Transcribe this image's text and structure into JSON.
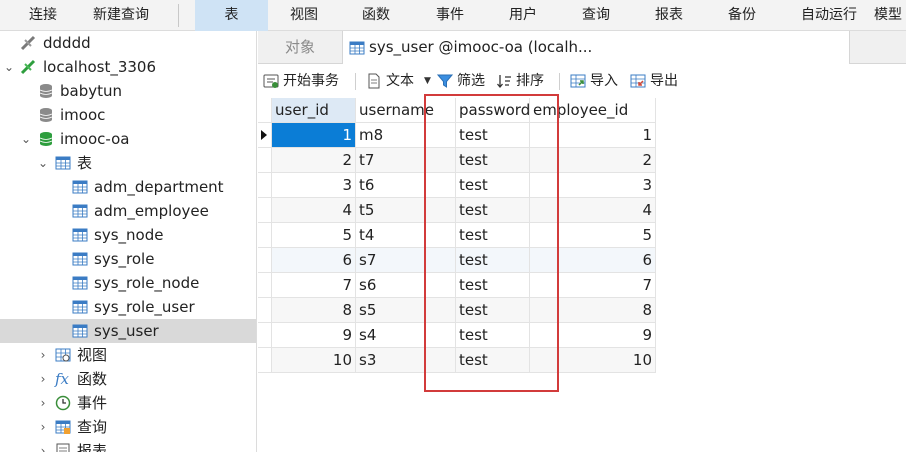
{
  "menubar": {
    "items": [
      {
        "label": "连接"
      },
      {
        "label": "新建查询"
      },
      {
        "label": "表"
      },
      {
        "label": "视图"
      },
      {
        "label": "函数"
      },
      {
        "label": "事件"
      },
      {
        "label": "用户"
      },
      {
        "label": "查询"
      },
      {
        "label": "报表"
      },
      {
        "label": "备份"
      },
      {
        "label": "自动运行"
      },
      {
        "label": "模型"
      }
    ],
    "active": "表"
  },
  "sidebar": {
    "items": [
      {
        "label": "ddddd",
        "icon": "connection-icon"
      },
      {
        "label": "localhost_3306",
        "icon": "connection-icon"
      },
      {
        "label": "babytun",
        "icon": "database-icon"
      },
      {
        "label": "imooc",
        "icon": "database-icon"
      },
      {
        "label": "imooc-oa",
        "icon": "database-icon"
      },
      {
        "label": "表",
        "icon": "tables-folder-icon"
      },
      {
        "label": "adm_department",
        "icon": "table-icon"
      },
      {
        "label": "adm_employee",
        "icon": "table-icon"
      },
      {
        "label": "sys_node",
        "icon": "table-icon"
      },
      {
        "label": "sys_role",
        "icon": "table-icon"
      },
      {
        "label": "sys_role_node",
        "icon": "table-icon"
      },
      {
        "label": "sys_role_user",
        "icon": "table-icon"
      },
      {
        "label": "sys_user",
        "icon": "table-icon"
      },
      {
        "label": "视图",
        "icon": "views-icon"
      },
      {
        "label": "函数",
        "icon": "function-icon"
      },
      {
        "label": "事件",
        "icon": "event-icon"
      },
      {
        "label": "查询",
        "icon": "query-icon"
      },
      {
        "label": "报表",
        "icon": "report-icon"
      }
    ],
    "selected": "sys_user"
  },
  "tabs": {
    "objects": "对象",
    "active": "sys_user @imooc-oa (localh..."
  },
  "toolbar": {
    "begin_transaction": "开始事务",
    "text": "文本",
    "filter": "筛选",
    "sort": "排序",
    "import": "导入",
    "export": "导出"
  },
  "grid": {
    "columns": [
      "user_id",
      "username",
      "password",
      "employee_id"
    ],
    "rows": [
      [
        "1",
        "m8",
        "test",
        "1"
      ],
      [
        "2",
        "t7",
        "test",
        "2"
      ],
      [
        "3",
        "t6",
        "test",
        "3"
      ],
      [
        "4",
        "t5",
        "test",
        "4"
      ],
      [
        "5",
        "t4",
        "test",
        "5"
      ],
      [
        "6",
        "s7",
        "test",
        "6"
      ],
      [
        "7",
        "s6",
        "test",
        "7"
      ],
      [
        "8",
        "s5",
        "test",
        "8"
      ],
      [
        "9",
        "s4",
        "test",
        "9"
      ],
      [
        "10",
        "s3",
        "test",
        "10"
      ]
    ]
  },
  "colors": {
    "selection": "#0b7dd6",
    "annotation": "#d23b3b",
    "active_tab_bg": "#cfe3f5",
    "db_active": "#2e9e3e"
  }
}
